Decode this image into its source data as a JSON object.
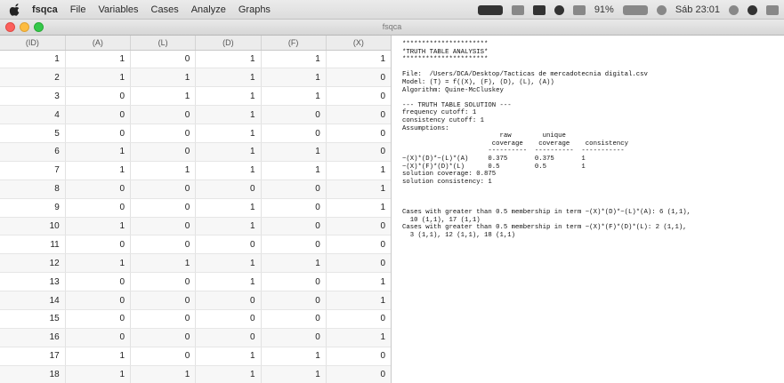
{
  "menubar": {
    "app_name": "fsqca",
    "items": [
      "File",
      "Variables",
      "Cases",
      "Analyze",
      "Graphs"
    ],
    "battery": "91%",
    "clock": "Sáb 23:01"
  },
  "window": {
    "title": "fsqca"
  },
  "grid": {
    "columns": [
      "(ID)",
      "(A)",
      "(L)",
      "(D)",
      "(F)",
      "(X)"
    ],
    "rows": [
      [
        "1",
        "1",
        "0",
        "1",
        "1",
        "1"
      ],
      [
        "2",
        "1",
        "1",
        "1",
        "1",
        "0"
      ],
      [
        "3",
        "0",
        "1",
        "1",
        "1",
        "0"
      ],
      [
        "4",
        "0",
        "0",
        "1",
        "0",
        "0"
      ],
      [
        "5",
        "0",
        "0",
        "1",
        "0",
        "0"
      ],
      [
        "6",
        "1",
        "0",
        "1",
        "1",
        "0"
      ],
      [
        "7",
        "1",
        "1",
        "1",
        "1",
        "1"
      ],
      [
        "8",
        "0",
        "0",
        "0",
        "0",
        "1"
      ],
      [
        "9",
        "0",
        "0",
        "1",
        "0",
        "1"
      ],
      [
        "10",
        "1",
        "0",
        "1",
        "0",
        "0"
      ],
      [
        "11",
        "0",
        "0",
        "0",
        "0",
        "0"
      ],
      [
        "12",
        "1",
        "1",
        "1",
        "1",
        "0"
      ],
      [
        "13",
        "0",
        "0",
        "1",
        "0",
        "1"
      ],
      [
        "14",
        "0",
        "0",
        "0",
        "0",
        "1"
      ],
      [
        "15",
        "0",
        "0",
        "0",
        "0",
        "0"
      ],
      [
        "16",
        "0",
        "0",
        "0",
        "0",
        "1"
      ],
      [
        "17",
        "1",
        "0",
        "1",
        "1",
        "0"
      ],
      [
        "18",
        "1",
        "1",
        "1",
        "1",
        "0"
      ]
    ]
  },
  "output": {
    "lines": [
      "**********************",
      "*TRUTH TABLE ANALYSIS*",
      "**********************",
      "",
      "File:  /Users/DCA/Desktop/Tacticas de mercadotecnia digital.csv",
      "Model: (T) = f((X), (F), (D), (L), (A))",
      "Algorithm: Quine-McCluskey",
      "",
      "--- TRUTH TABLE SOLUTION ---",
      "frequency cutoff: 1",
      "consistency cutoff: 1",
      "Assumptions:",
      "                         raw        unique",
      "                       coverage    coverage    consistency",
      "                      ----------  ----------  -----------",
      "~(X)*(D)*~(L)*(A)     0.375       0.375       1",
      "~(X)*(F)*(D)*(L)      0.5         0.5         1",
      "solution coverage: 0.875",
      "solution consistency: 1",
      "",
      "",
      "",
      "Cases with greater than 0.5 membership in term ~(X)*(D)*~(L)*(A): 6 (1,1),",
      "  10 (1,1), 17 (1,1)",
      "Cases with greater than 0.5 membership in term ~(X)*(F)*(D)*(L): 2 (1,1),",
      "  3 (1,1), 12 (1,1), 18 (1,1)"
    ]
  }
}
